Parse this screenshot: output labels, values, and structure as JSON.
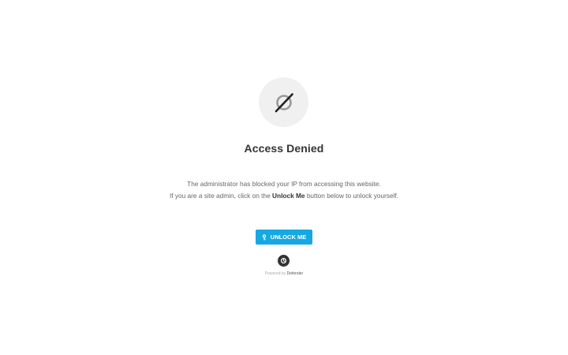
{
  "icon": "blocked-icon",
  "title": "Access Denied",
  "message": {
    "line1": "The administrator has blocked your IP from accessing this website.",
    "line2_before": "If you are a site admin, click on the ",
    "line2_bold": "Unlock Me",
    "line2_after": " button below to unlock yourself."
  },
  "button": {
    "label": "UNLOCK ME",
    "icon": "key-icon"
  },
  "footer": {
    "logo_icon": "defender-logo-icon",
    "powered_prefix": "Powered by",
    "brand": "Defender"
  },
  "colors": {
    "accent": "#17a8e3",
    "title": "#333333",
    "text": "#666666",
    "icon_bg": "#f0f0f0"
  }
}
